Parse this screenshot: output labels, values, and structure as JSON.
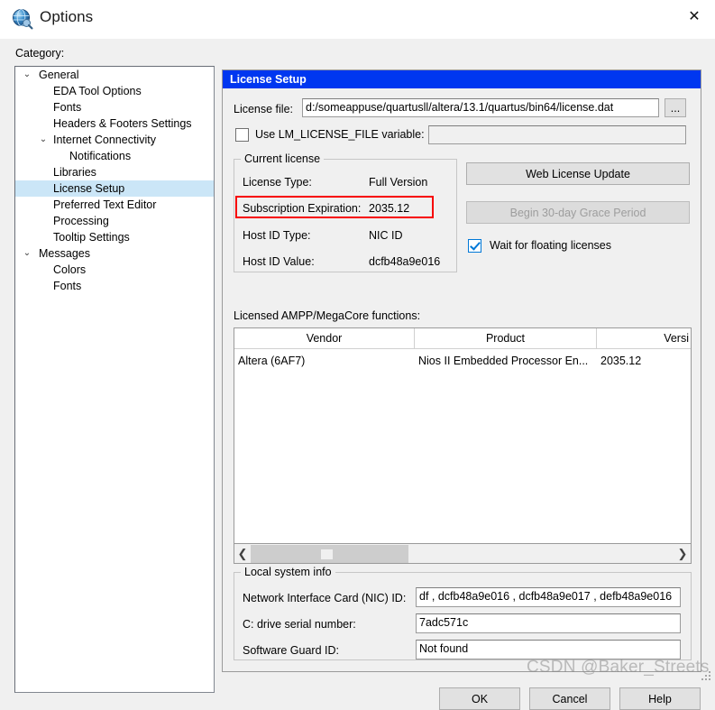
{
  "window": {
    "title": "Options",
    "icon": "globe-icon",
    "close_label": "✕"
  },
  "sidebar": {
    "label": "Category:",
    "items": [
      {
        "label": "General",
        "level": 0,
        "chevron": "⌄",
        "selected": false
      },
      {
        "label": "EDA Tool Options",
        "level": 1,
        "chevron": "",
        "selected": false
      },
      {
        "label": "Fonts",
        "level": 1,
        "chevron": "",
        "selected": false
      },
      {
        "label": "Headers & Footers Settings",
        "level": 1,
        "chevron": "",
        "selected": false
      },
      {
        "label": "Internet Connectivity",
        "level": 1,
        "chevron": "⌄",
        "selected": false
      },
      {
        "label": "Notifications",
        "level": 2,
        "chevron": "",
        "selected": false
      },
      {
        "label": "Libraries",
        "level": 1,
        "chevron": "",
        "selected": false
      },
      {
        "label": "License Setup",
        "level": 1,
        "chevron": "",
        "selected": true
      },
      {
        "label": "Preferred Text Editor",
        "level": 1,
        "chevron": "",
        "selected": false
      },
      {
        "label": "Processing",
        "level": 1,
        "chevron": "",
        "selected": false
      },
      {
        "label": "Tooltip Settings",
        "level": 1,
        "chevron": "",
        "selected": false
      },
      {
        "label": "Messages",
        "level": 0,
        "chevron": "⌄",
        "selected": false
      },
      {
        "label": "Colors",
        "level": 1,
        "chevron": "",
        "selected": false
      },
      {
        "label": "Fonts",
        "level": 1,
        "chevron": "",
        "selected": false
      }
    ]
  },
  "panel": {
    "title": "License Setup",
    "license_file_label": "License file:",
    "license_file_value": "d:/someappuse/quartusll/altera/13.1/quartus/bin64/license.dat",
    "browse_label": "...",
    "lm_license_checkbox_label": "Use LM_LICENSE_FILE variable:",
    "lm_license_checked": false,
    "lm_license_value": "",
    "current_license": {
      "group_title": "Current license",
      "rows": [
        {
          "label": "License Type:",
          "value": "Full Version"
        },
        {
          "label": "Subscription Expiration:",
          "value": "2035.12"
        },
        {
          "label": "Host ID Type:",
          "value": "NIC ID"
        },
        {
          "label": "Host ID Value:",
          "value": "dcfb48a9e016"
        }
      ]
    },
    "web_license_update_label": "Web License Update",
    "grace_period_label": "Begin 30-day Grace Period",
    "grace_period_disabled": true,
    "wait_floating_label": "Wait for floating licenses",
    "wait_floating_checked": true,
    "functions_label": "Licensed AMPP/MegaCore functions:",
    "table": {
      "columns": [
        "Vendor",
        "Product",
        "Versi"
      ],
      "rows": [
        [
          "Altera (6AF7)",
          "Nios II Embedded Processor En...",
          "2035.12"
        ]
      ]
    },
    "local_system_info": {
      "group_title": "Local system info",
      "rows": [
        {
          "label": "Network Interface Card (NIC) ID:",
          "value": "df , dcfb48a9e016 , dcfb48a9e017 , defb48a9e016"
        },
        {
          "label": "C: drive serial number:",
          "value": "7adc571c"
        },
        {
          "label": "Software Guard ID:",
          "value": "Not found"
        }
      ]
    }
  },
  "footer": {
    "ok_label": "OK",
    "cancel_label": "Cancel",
    "help_label": "Help"
  },
  "watermark": "CSDN @Baker_Streets",
  "colors": {
    "panel_header_blue": "#0037f0",
    "selection_blue": "#cbe6f7",
    "highlight_red": "#f70000",
    "checkbox_accent": "#0078d7"
  }
}
